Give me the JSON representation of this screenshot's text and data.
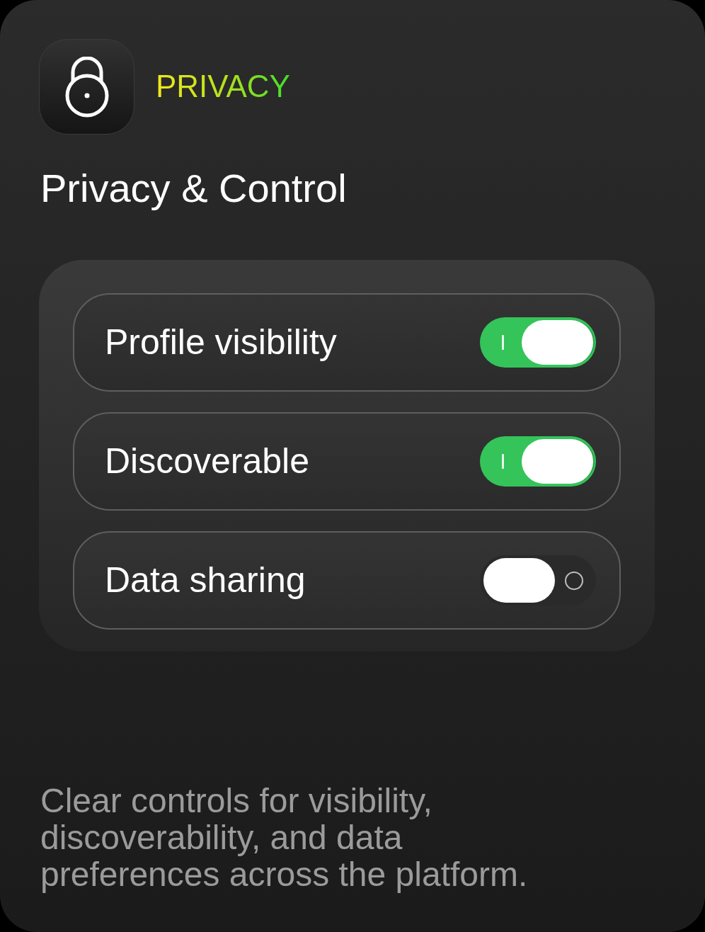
{
  "header": {
    "category": "PRIVACY",
    "title": "Privacy & Control"
  },
  "settings": [
    {
      "label": "Profile visibility",
      "on": true
    },
    {
      "label": "Discoverable",
      "on": true
    },
    {
      "label": "Data sharing",
      "on": false
    }
  ],
  "description": "Clear controls for visibility, discoverability, and data preferences across the platform."
}
